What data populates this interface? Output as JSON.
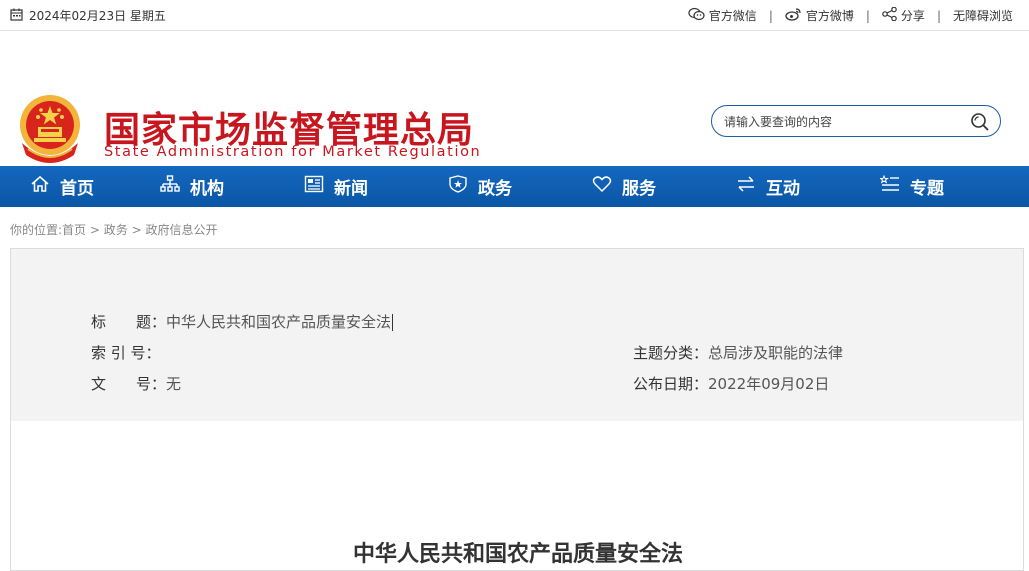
{
  "topbar": {
    "date": "2024年02月23日 星期五",
    "wechat": "官方微信",
    "weibo": "官方微博",
    "share": "分享",
    "accessible": "无障碍浏览",
    "sep": "|"
  },
  "header": {
    "title_cn": "国家市场监督管理总局",
    "title_en": "State Administration for Market Regulation",
    "search_placeholder": "请输入要查询的内容"
  },
  "nav": {
    "items": [
      {
        "label": "首页",
        "icon": "home-icon"
      },
      {
        "label": "机构",
        "icon": "org-chart-icon"
      },
      {
        "label": "新闻",
        "icon": "news-icon"
      },
      {
        "label": "政务",
        "icon": "shield-icon"
      },
      {
        "label": "服务",
        "icon": "heart-icon"
      },
      {
        "label": "互动",
        "icon": "exchange-icon"
      },
      {
        "label": "专题",
        "icon": "list-star-icon"
      }
    ]
  },
  "breadcrumb": {
    "prefix": "你的位置:",
    "items": [
      "首页",
      "政务",
      "政府信息公开"
    ],
    "sep": ">"
  },
  "meta": {
    "title_label": "标　　题：",
    "title_value": "中华人民共和国农产品质量安全法",
    "index_label": "索 引 号：",
    "index_value": "",
    "doc_label": "文　　号：",
    "doc_value": "无",
    "category_label": "主题分类：",
    "category_value": "总局涉及职能的法律",
    "date_label": "公布日期：",
    "date_value": "2022年09月02日"
  },
  "document": {
    "title": "中华人民共和国农产品质量安全法"
  },
  "colors": {
    "brand_red": "#c8161e",
    "nav_blue": "#0a56a6"
  }
}
